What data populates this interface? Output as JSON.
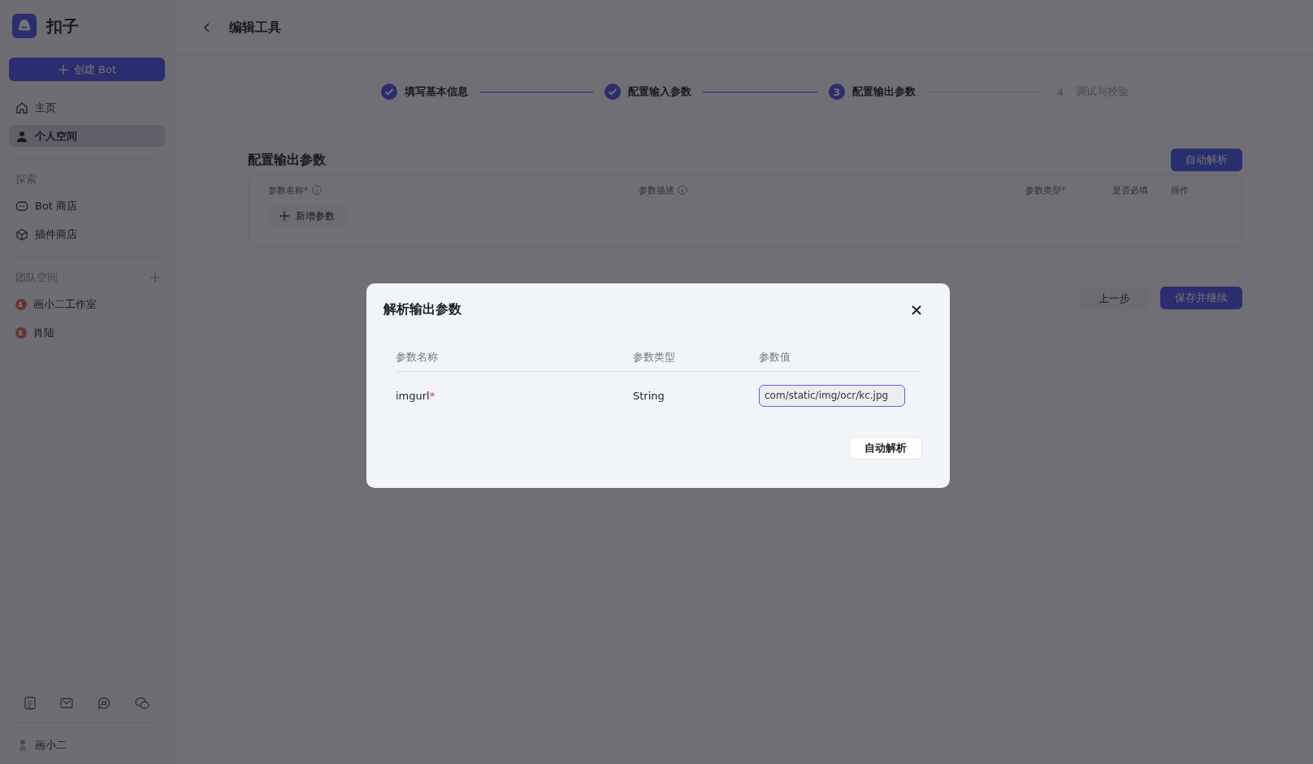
{
  "sidebar": {
    "brand": "扣子",
    "create_button": "创建 Bot",
    "nav": [
      {
        "label": "主页",
        "selected": false
      },
      {
        "label": "个人空间",
        "selected": true
      }
    ],
    "explore_heading": "探索",
    "explore": [
      {
        "label": "Bot 商店"
      },
      {
        "label": "插件商店"
      }
    ],
    "team_heading": "团队空间",
    "teams": [
      {
        "label": "画小二工作室"
      },
      {
        "label": "肖陆"
      }
    ],
    "user": "画小二"
  },
  "header": {
    "title": "编辑工具"
  },
  "steps": [
    {
      "kind": "done",
      "label": "填写基本信息"
    },
    {
      "kind": "done",
      "label": "配置输入参数"
    },
    {
      "kind": "current",
      "number": "3",
      "label": "配置输出参数"
    },
    {
      "kind": "pending",
      "number": "4",
      "label": "调试与校验"
    }
  ],
  "section": {
    "title": "配置输出参数",
    "auto_button": "自动解析",
    "columns": [
      {
        "label": "参数名称",
        "required_mark": "*",
        "info": true
      },
      {
        "label": "参数描述",
        "info": true
      },
      {
        "label": "参数类型",
        "required_mark": "*",
        "info": false
      },
      {
        "label": "是否必填",
        "info": false
      },
      {
        "label": "操作",
        "info": false
      }
    ],
    "add_button": "新增参数",
    "back_button": "上一步",
    "save_button": "保存并继续"
  },
  "dialog": {
    "title": "解析输出参数",
    "columns": [
      "参数名称",
      "参数类型",
      "参数值"
    ],
    "rows": [
      {
        "name": "imgurl",
        "required_mark": "*",
        "type": "String",
        "value": "com/static/img/ocr/kc.jpg"
      }
    ],
    "button": "自动解析"
  }
}
